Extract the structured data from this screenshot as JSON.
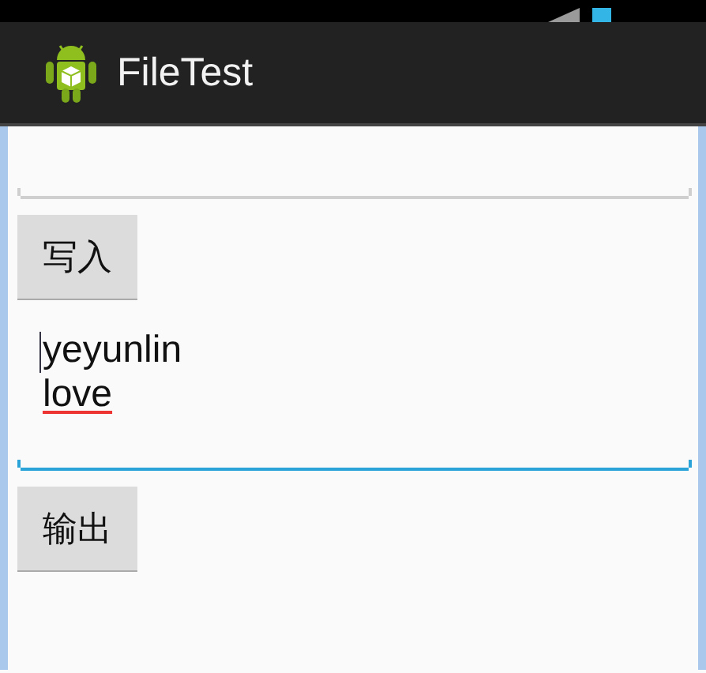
{
  "action_bar": {
    "title": "FileTest"
  },
  "form": [
    {
      "kind": "field",
      "focused": false
    },
    {
      "kind": "button",
      "label": "写入"
    },
    {
      "kind": "field",
      "focused": true,
      "lines": [
        {
          "text": "yeyunlin",
          "misspelled": false
        },
        {
          "text": "love",
          "misspelled": true
        }
      ]
    },
    {
      "kind": "button",
      "label": "输出"
    }
  ]
}
